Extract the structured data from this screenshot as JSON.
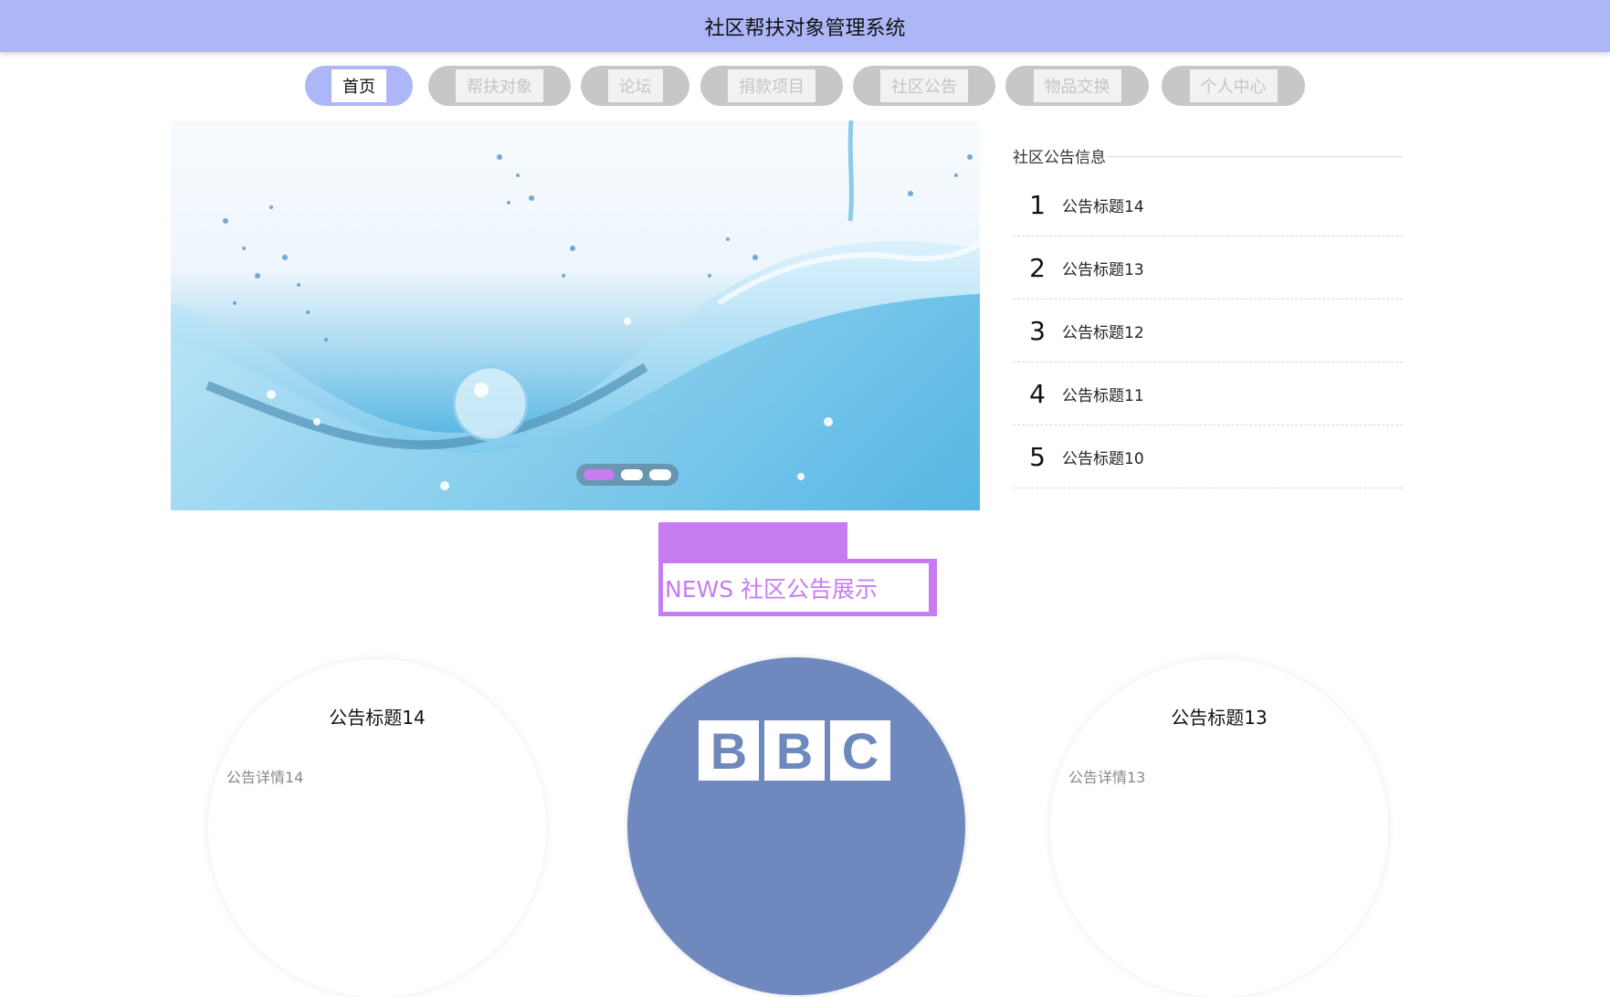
{
  "header": {
    "title": "社区帮扶对象管理系统"
  },
  "nav": {
    "items": [
      {
        "label": "首页",
        "active": true
      },
      {
        "label": "帮扶对象",
        "active": false
      },
      {
        "label": "论坛",
        "active": false
      },
      {
        "label": "捐款项目",
        "active": false
      },
      {
        "label": "社区公告",
        "active": false
      },
      {
        "label": "物品交换",
        "active": false
      },
      {
        "label": "个人中心",
        "active": false
      }
    ]
  },
  "carousel": {
    "slide_count": 3,
    "active_index": 0
  },
  "notices": {
    "heading": "社区公告信息",
    "items": [
      {
        "num": "1",
        "title": "公告标题14"
      },
      {
        "num": "2",
        "title": "公告标题13"
      },
      {
        "num": "3",
        "title": "公告标题12"
      },
      {
        "num": "4",
        "title": "公告标题11"
      },
      {
        "num": "5",
        "title": "公告标题10"
      }
    ]
  },
  "section": {
    "title": "NEWS 社区公告展示"
  },
  "cards": [
    {
      "title": "公告标题14",
      "desc": "公告详情14"
    },
    {
      "logo": "BBC",
      "logo_letters": [
        "B",
        "B",
        "C"
      ]
    },
    {
      "title": "公告标题13",
      "desc": "公告详情13"
    }
  ],
  "colors": {
    "header_bg": "#adb6f6",
    "nav_inactive": "#c7c7c7",
    "accent_purple": "#c77cf2",
    "bbc_blue": "#6f89bf"
  }
}
